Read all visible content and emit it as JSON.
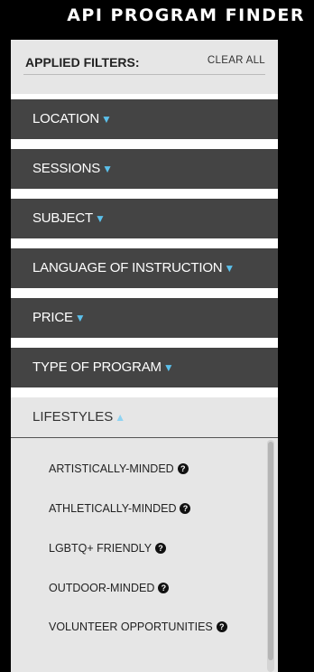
{
  "app_title": "API PROGRAM FINDER",
  "applied_filters": {
    "label": "APPLIED FILTERS:",
    "clear_all": "CLEAR ALL"
  },
  "filters": [
    {
      "label": "LOCATION",
      "state": "collapsed"
    },
    {
      "label": "SESSIONS",
      "state": "collapsed"
    },
    {
      "label": "SUBJECT",
      "state": "collapsed"
    },
    {
      "label": "LANGUAGE OF INSTRUCTION",
      "state": "collapsed"
    },
    {
      "label": "PRICE",
      "state": "collapsed"
    },
    {
      "label": "TYPE OF PROGRAM",
      "state": "collapsed"
    }
  ],
  "lifestyles": {
    "label": "LIFESTYLES",
    "state": "expanded",
    "options": [
      "ARTISTICALLY-MINDED",
      "ATHLETICALLY-MINDED",
      "LGBTQ+ FRIENDLY",
      "OUTDOOR-MINDED",
      "VOLUNTEER OPPORTUNITIES"
    ]
  },
  "icons": {
    "collapsed_arrow": "▼",
    "expanded_arrow": "▲",
    "help": "?"
  },
  "colors": {
    "header_bg": "#000000",
    "filter_bg": "#444444",
    "arrow_accent": "#5bc0eb",
    "panel_light": "#e6e6e6"
  }
}
